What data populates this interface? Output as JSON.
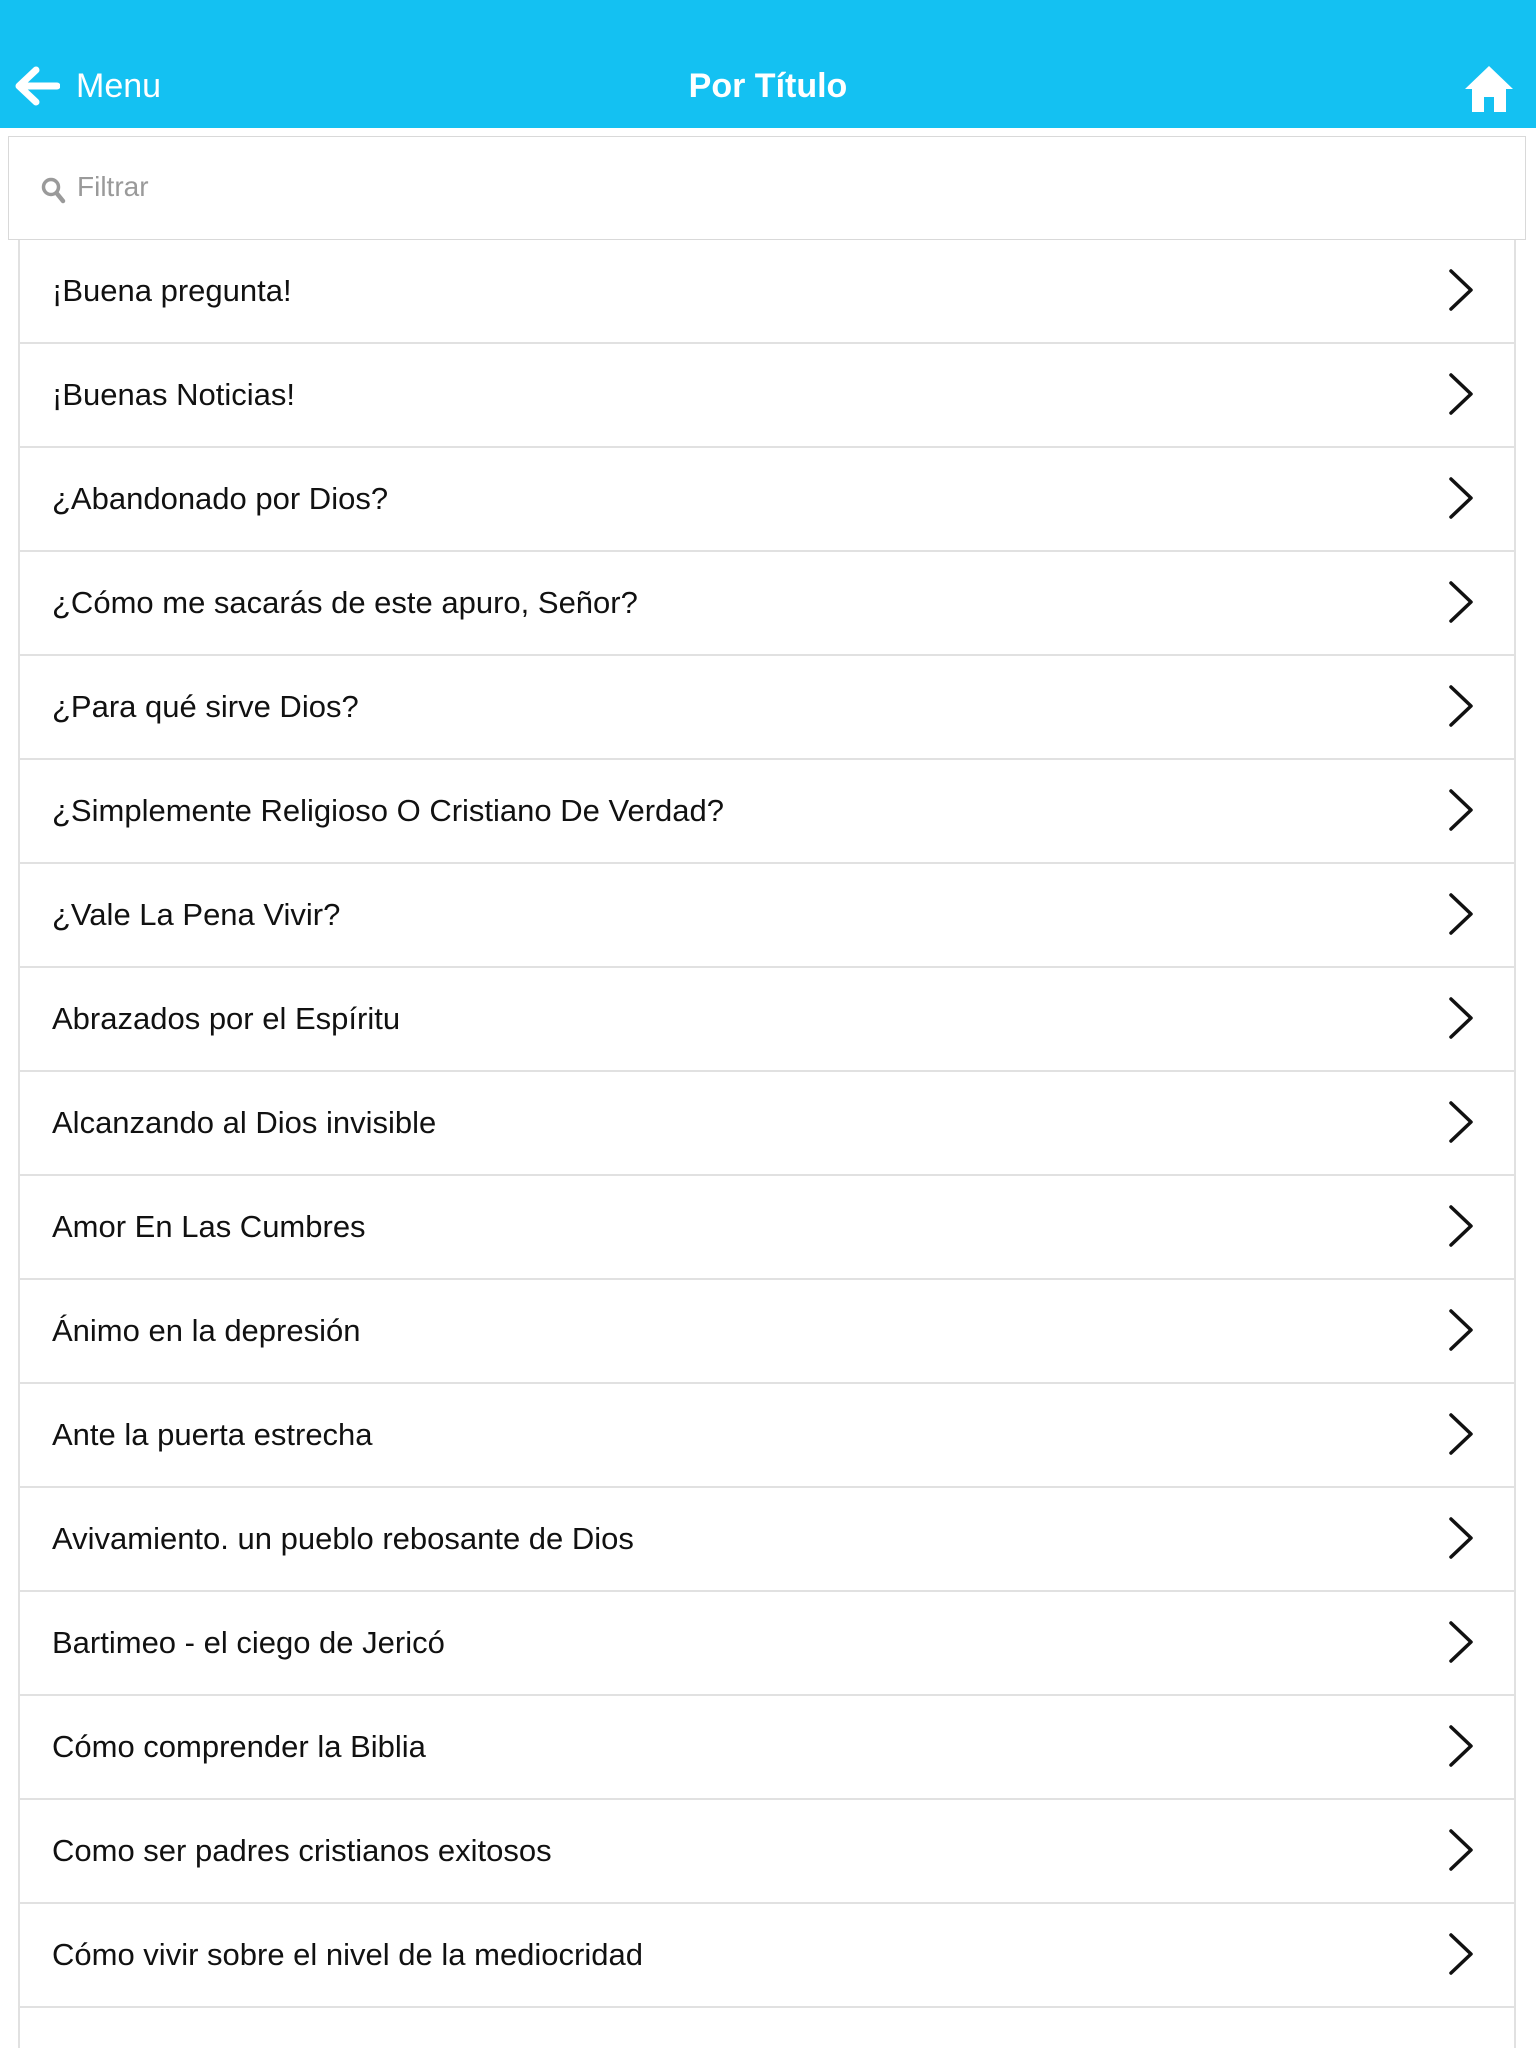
{
  "nav": {
    "back_label": "Menu",
    "title": "Por Título",
    "back_icon": "arrow-left-icon",
    "home_icon": "home-icon"
  },
  "search": {
    "placeholder": "Filtrar",
    "value": "",
    "icon": "search-icon"
  },
  "colors": {
    "navbar": "#14c1f2",
    "divider": "#e1e1e1",
    "text": "#111111"
  },
  "items": [
    {
      "label": "¡Buena pregunta!"
    },
    {
      "label": "¡Buenas Noticias!"
    },
    {
      "label": "¿Abandonado por Dios?"
    },
    {
      "label": "¿Cómo me sacarás de este apuro, Señor?"
    },
    {
      "label": "¿Para qué sirve Dios?"
    },
    {
      "label": "¿Simplemente Religioso O Cristiano De Verdad?"
    },
    {
      "label": "¿Vale La Pena Vivir?"
    },
    {
      "label": "Abrazados por el Espíritu"
    },
    {
      "label": "Alcanzando al Dios invisible"
    },
    {
      "label": "Amor En Las Cumbres"
    },
    {
      "label": "Ánimo en la depresión"
    },
    {
      "label": "Ante la puerta estrecha"
    },
    {
      "label": "Avivamiento. un pueblo rebosante de Dios"
    },
    {
      "label": "Bartimeo - el ciego de Jericó"
    },
    {
      "label": "Cómo comprender la Biblia"
    },
    {
      "label": "Como ser padres cristianos exitosos"
    },
    {
      "label": "Cómo vivir sobre el nivel de la mediocridad"
    }
  ]
}
